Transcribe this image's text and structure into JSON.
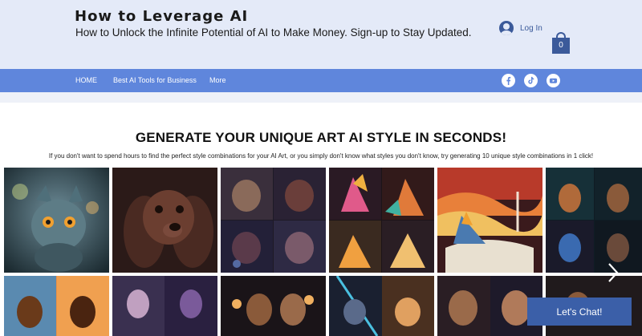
{
  "header": {
    "site_title": "How to Leverage AI",
    "site_subtitle": "How to Unlock the Infinite Potential of AI to Make Money. Sign-up to Stay Updated.",
    "login_label": "Log In",
    "cart_count": "0"
  },
  "nav": {
    "items": [
      "HOME",
      "Best AI Tools for Business",
      "More"
    ],
    "social_icons": [
      "facebook-icon",
      "tiktok-icon",
      "youtube-icon"
    ]
  },
  "section": {
    "headline": "GENERATE YOUR UNIQUE ART AI STYLE IN SECONDS!",
    "description": "If you don't want to spend hours to find the perfect style combinations for your AI Art, or you simply don't know what styles you don't know, try generating 10 unique style combinations in 1 click!"
  },
  "gallery": {
    "images": [
      "cyber cat with glowing eyes",
      "cocker spaniel portrait",
      "four spaniel portraits",
      "four origami cats",
      "layered paper cat landscape",
      "cyberpunk dogs",
      "dogs at sunset",
      "dogs in purple light",
      "spaniels with lamps",
      "neon cats",
      "cocker spaniels",
      "dog portrait"
    ]
  },
  "chat": {
    "label": "Let's Chat!"
  },
  "colors": {
    "header_bg": "#e4eaf8",
    "nav_bg": "#5f86dc",
    "accent": "#3b5a9a",
    "chat_bg": "#3b5fa8"
  }
}
